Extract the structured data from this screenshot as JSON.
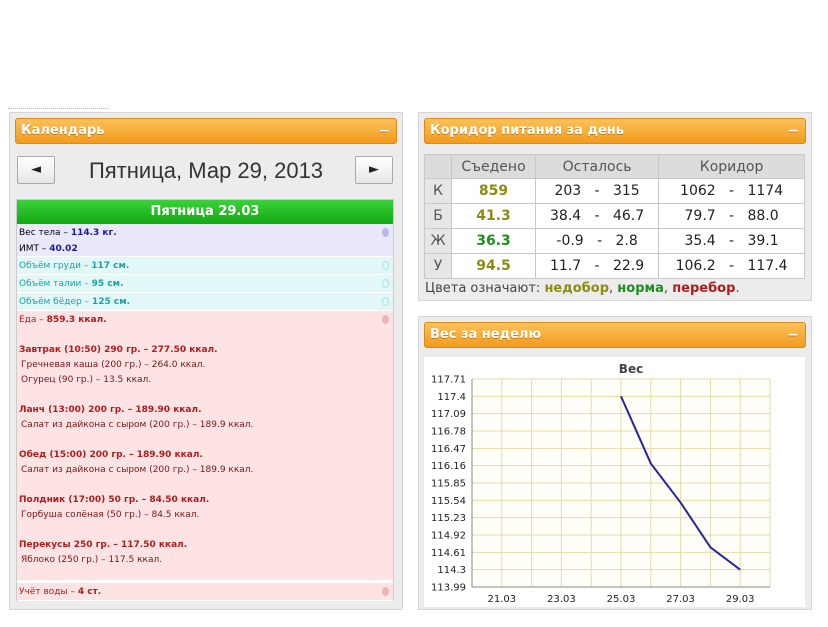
{
  "calendar": {
    "header_title": "Календарь",
    "collapse": "−",
    "prev_label": "◄",
    "next_label": "►",
    "date_title": "Пятница, Мар 29, 2013",
    "day_header": "Пятница 29.03",
    "weight": {
      "label": "Вес тела –",
      "value": "114.3 кг."
    },
    "bmi": {
      "label": "ИМТ –",
      "value": "40.02"
    },
    "chest": {
      "label": "Объём груди –",
      "value": "117 см."
    },
    "waist": {
      "label": "Объём талии –",
      "value": "95 см."
    },
    "hips": {
      "label": "Объём бёдер –",
      "value": "125 см."
    },
    "food_total": {
      "label": "Еда –",
      "value": "859.3 ккал."
    },
    "meals": [
      {
        "title": "Завтрак (10:50) 290 гр. – 277.50 ккал.",
        "items": [
          "Гречневая каша (200 гр.) – 264.0 ккал.",
          "Огурец (90 гр.) – 13.5 ккал."
        ]
      },
      {
        "title": "Ланч (13:00) 200 гр. – 189.90 ккал.",
        "items": [
          "Салат из дайкона с сыром (200 гр.) – 189.9 ккал."
        ]
      },
      {
        "title": "Обед (15:00) 200 гр. – 189.90 ккал.",
        "items": [
          "Салат из дайкона с сыром (200 гр.) – 189.9 ккал."
        ]
      },
      {
        "title": "Полдник (17:00) 50 гр. – 84.50 ккал.",
        "items": [
          "Горбуша солёная (50 гр.) – 84.5 ккал."
        ]
      },
      {
        "title": "Перекусы 250 гр. – 117.50 ккал.",
        "items": [
          "Яблоко (250 гр.) – 117.5 ккал."
        ]
      }
    ],
    "water": {
      "label": "Учёт воды –",
      "value": "4 ст."
    }
  },
  "corridor": {
    "header_title": "Коридор питания за день",
    "collapse": "−",
    "columns": [
      "",
      "Съедено",
      "Осталось",
      "Коридор"
    ],
    "dash": "-",
    "rows": [
      {
        "label": "К",
        "eaten": "859",
        "eaten_color": "#8c8c14",
        "left_min": "203",
        "left_max": "315",
        "corr_min": "1062",
        "corr_max": "1174"
      },
      {
        "label": "Б",
        "eaten": "41.3",
        "eaten_color": "#8c8c14",
        "left_min": "38.4",
        "left_max": "46.7",
        "corr_min": "79.7",
        "corr_max": "88.0"
      },
      {
        "label": "Ж",
        "eaten": "36.3",
        "eaten_color": "#1d8f1d",
        "left_min": "-0.9",
        "left_max": "2.8",
        "corr_min": "35.4",
        "corr_max": "39.1"
      },
      {
        "label": "У",
        "eaten": "94.5",
        "eaten_color": "#8c8c14",
        "left_min": "11.7",
        "left_max": "22.9",
        "corr_min": "106.2",
        "corr_max": "117.4"
      }
    ],
    "legend_prefix": "Цвета означают:",
    "legend_under": "недобор",
    "legend_norm": "норма",
    "legend_over": "перебор",
    "legend_sep": ",",
    "legend_end": ".",
    "colors": {
      "under": "#8c8c14",
      "norm": "#1d8f1d",
      "over": "#b01c1c"
    }
  },
  "week": {
    "header_title": "Вес за неделю",
    "collapse": "−"
  },
  "chart_data": {
    "type": "line",
    "title": "Вес",
    "x_ticks": [
      "21.03",
      "23.03",
      "25.03",
      "27.03",
      "29.03"
    ],
    "y_ticks": [
      "117.71",
      "117.4",
      "117.09",
      "116.78",
      "116.47",
      "116.16",
      "115.85",
      "115.54",
      "115.23",
      "114.92",
      "114.61",
      "114.3",
      "113.99"
    ],
    "ylim": [
      113.99,
      117.71
    ],
    "x_domain": [
      "20.03",
      "30.03"
    ],
    "series": [
      {
        "x": [
          "25.03",
          "26.03",
          "27.03",
          "28.03",
          "29.03"
        ],
        "values": [
          117.4,
          116.2,
          115.5,
          114.7,
          114.3
        ],
        "color": "#2626a0"
      }
    ],
    "grid": true,
    "grid_color": "#e8d9a4"
  }
}
